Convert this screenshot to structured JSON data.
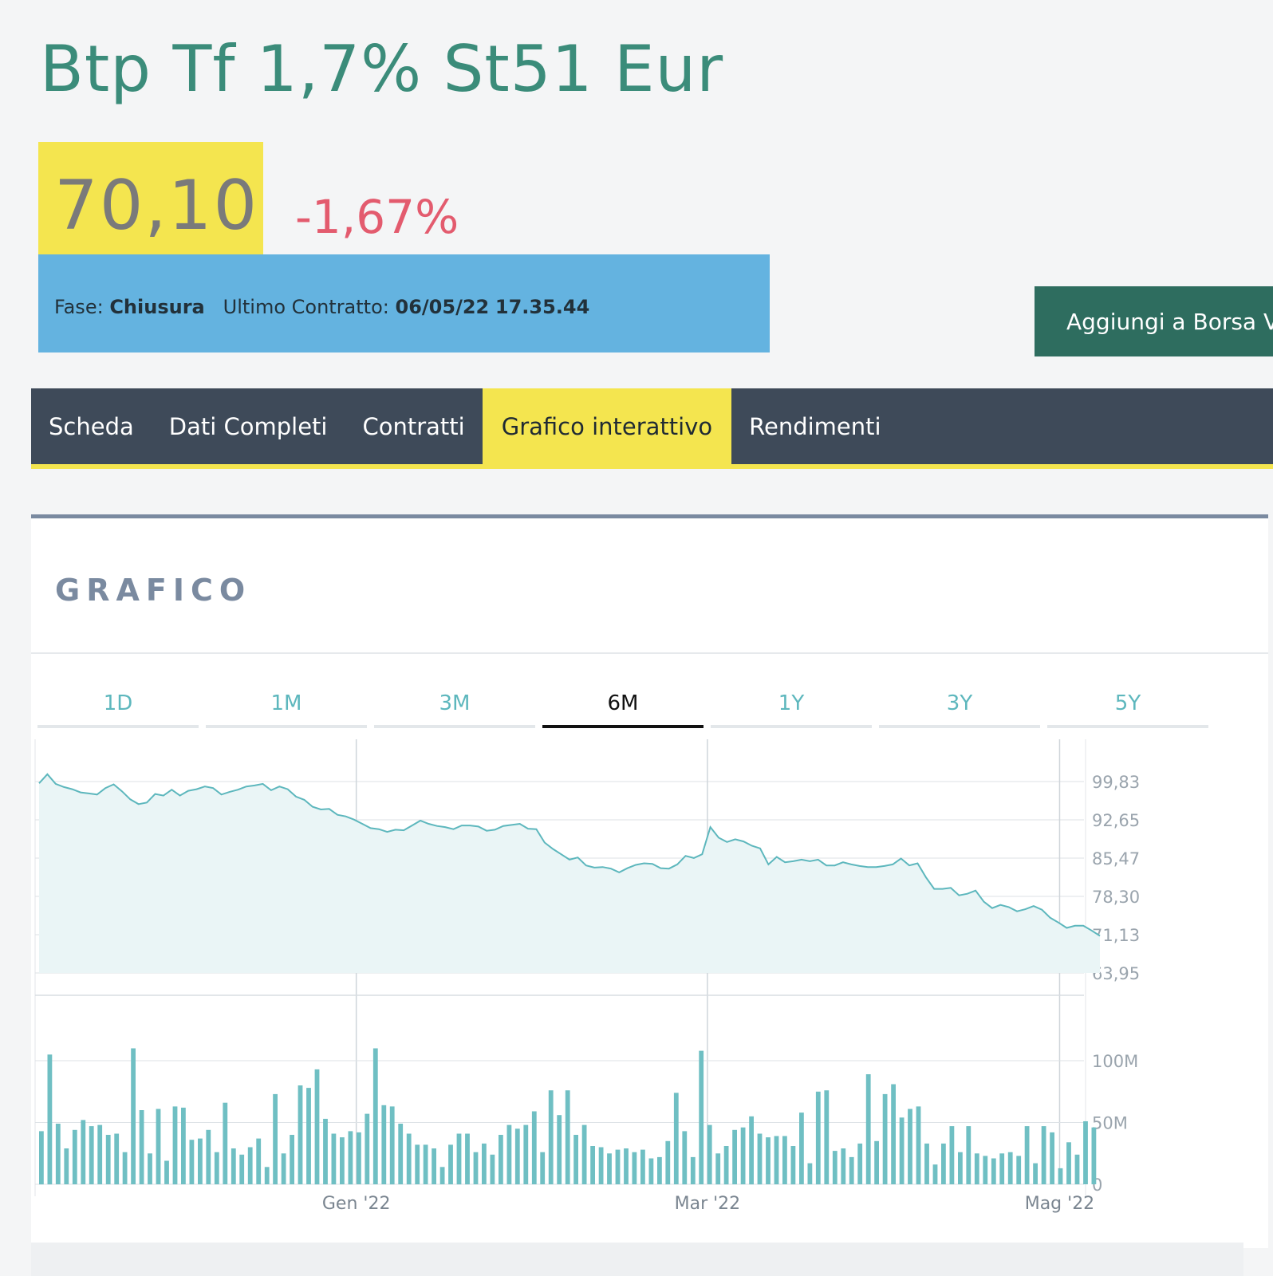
{
  "page": {
    "title": "Btp Tf 1,7% St51 Eur",
    "price": "70,10",
    "change": "-1,67%",
    "phase_label": "Fase:",
    "phase_value": "Chiusura",
    "last_contract_label": "Ultimo Contratto:",
    "last_contract_date": "06/05/22",
    "last_contract_time": "17.35.44",
    "add_button": "Aggiungi a Borsa V"
  },
  "tabs": [
    {
      "label": "Scheda",
      "active": false
    },
    {
      "label": "Dati Completi",
      "active": false
    },
    {
      "label": "Contratti",
      "active": false
    },
    {
      "label": "Grafico interattivo",
      "active": true
    },
    {
      "label": "Rendimenti",
      "active": false
    }
  ],
  "panel": {
    "title": "GRAFICO"
  },
  "ranges": [
    {
      "label": "1D",
      "active": false
    },
    {
      "label": "1M",
      "active": false
    },
    {
      "label": "3M",
      "active": false
    },
    {
      "label": "6M",
      "active": true
    },
    {
      "label": "1Y",
      "active": false
    },
    {
      "label": "3Y",
      "active": false
    },
    {
      "label": "5Y",
      "active": false
    }
  ],
  "colors": {
    "accent_yellow": "#f4e54f",
    "info_blue": "#64b3e0",
    "title_green": "#3b8c7a",
    "negative_red": "#e35b6e",
    "line_teal": "#5db7bd",
    "nav_dark": "#3e4a59"
  },
  "chart_data": {
    "type": "line",
    "price": {
      "y_ticks": [
        "99,83",
        "92,65",
        "85,47",
        "78,30",
        "71,13",
        "63,95"
      ],
      "ylim": [
        63.95,
        99.83
      ],
      "values": [
        99.5,
        101.2,
        99.4,
        98.8,
        98.4,
        97.8,
        97.6,
        97.4,
        98.6,
        99.3,
        98.0,
        96.5,
        95.6,
        95.9,
        97.5,
        97.2,
        98.3,
        97.2,
        98.1,
        98.4,
        98.9,
        98.6,
        97.4,
        97.9,
        98.3,
        98.9,
        99.1,
        99.4,
        98.2,
        98.9,
        98.4,
        97.0,
        96.4,
        95.1,
        94.6,
        94.7,
        93.6,
        93.3,
        92.7,
        91.9,
        91.1,
        90.9,
        90.4,
        90.8,
        90.7,
        91.6,
        92.5,
        91.9,
        91.5,
        91.3,
        90.9,
        91.6,
        91.6,
        91.4,
        90.6,
        90.8,
        91.5,
        91.7,
        91.9,
        91.0,
        90.9,
        88.4,
        87.2,
        86.2,
        85.2,
        85.6,
        84.1,
        83.7,
        83.8,
        83.5,
        82.8,
        83.6,
        84.2,
        84.5,
        84.4,
        83.6,
        83.5,
        84.3,
        85.9,
        85.5,
        86.2,
        91.3,
        89.3,
        88.5,
        89.0,
        88.6,
        87.8,
        87.3,
        84.3,
        85.7,
        84.7,
        84.9,
        85.2,
        84.9,
        85.2,
        84.1,
        84.1,
        84.7,
        84.3,
        84.0,
        83.8,
        83.8,
        84.0,
        84.3,
        85.4,
        84.1,
        84.5,
        81.9,
        79.7,
        79.7,
        79.9,
        78.5,
        78.8,
        79.4,
        77.3,
        76.1,
        76.7,
        76.3,
        75.5,
        75.9,
        76.5,
        75.8,
        74.3,
        73.4,
        72.4,
        72.8,
        72.8,
        71.9,
        70.9
      ],
      "x_labels": [
        "Gen '22",
        "Mar '22",
        "Mag '22"
      ]
    },
    "volume": {
      "y_ticks": [
        "100M",
        "50M",
        "0"
      ],
      "ylim": [
        0,
        120
      ],
      "values": [
        43,
        105,
        49,
        29,
        44,
        52,
        47,
        48,
        40,
        41,
        26,
        110,
        60,
        25,
        61,
        19,
        63,
        62,
        36,
        37,
        44,
        26,
        66,
        29,
        24,
        30,
        37,
        14,
        73,
        25,
        40,
        80,
        78,
        93,
        53,
        41,
        38,
        43,
        42,
        57,
        110,
        64,
        63,
        49,
        41,
        32,
        32,
        29,
        14,
        32,
        41,
        41,
        26,
        33,
        24,
        40,
        48,
        45,
        48,
        59,
        26,
        76,
        56,
        76,
        40,
        48,
        31,
        30,
        25,
        28,
        29,
        26,
        28,
        21,
        22,
        35,
        74,
        43,
        22,
        108,
        48,
        25,
        31,
        44,
        46,
        55,
        41,
        38,
        39,
        39,
        31,
        58,
        17,
        75,
        76,
        27,
        29,
        22,
        33,
        89,
        35,
        73,
        81,
        54,
        61,
        63,
        33,
        16,
        33,
        47,
        26,
        47,
        25,
        23,
        21,
        25,
        26,
        23,
        47,
        17,
        47,
        42,
        13,
        34,
        24,
        51,
        46
      ],
      "x_labels": [
        "Gen '22",
        "Mar '22",
        "Mag '22"
      ]
    }
  }
}
